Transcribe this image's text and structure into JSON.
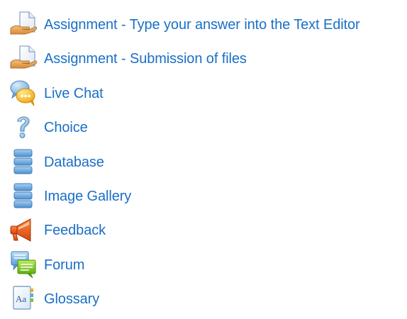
{
  "activities": [
    {
      "label": "Assignment - Type your answer into the Text Editor",
      "icon": "assignment-icon"
    },
    {
      "label": "Assignment - Submission of files",
      "icon": "assignment-icon"
    },
    {
      "label": "Live Chat",
      "icon": "chat-icon"
    },
    {
      "label": "Choice",
      "icon": "choice-icon"
    },
    {
      "label": "Database",
      "icon": "database-icon"
    },
    {
      "label": "Image Gallery",
      "icon": "database-icon"
    },
    {
      "label": "Feedback",
      "icon": "feedback-icon"
    },
    {
      "label": "Forum",
      "icon": "forum-icon"
    },
    {
      "label": "Glossary",
      "icon": "glossary-icon"
    }
  ],
  "colors": {
    "link": "#1a6fc7",
    "background": "#ffffff"
  }
}
